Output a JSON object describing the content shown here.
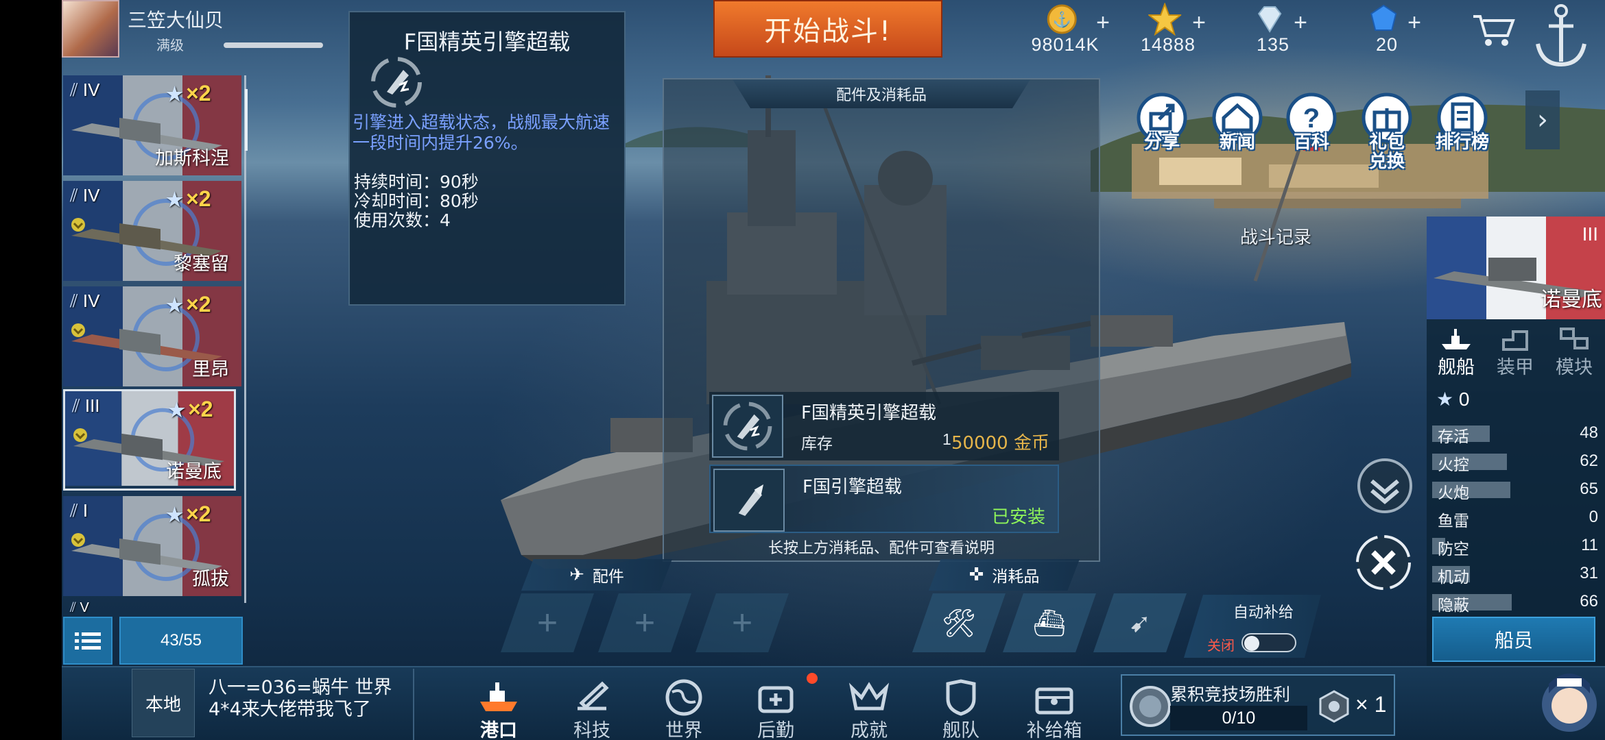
{
  "player": {
    "name": "三笠大仙贝",
    "level": "满级"
  },
  "start_battle": "开始战斗!",
  "resources": [
    {
      "icon": "gold-coin-icon",
      "value": "98014K",
      "color": "#f2b93a"
    },
    {
      "icon": "star-icon",
      "value": "14888",
      "color": "#f5c742"
    },
    {
      "icon": "diamond-icon",
      "value": "135",
      "color": "#d8e8f4"
    },
    {
      "icon": "blue-gem-icon",
      "value": "20",
      "color": "#3a8ff0"
    }
  ],
  "ship_list": [
    {
      "tier": "IV",
      "mult": "×2",
      "name": "加斯科涅"
    },
    {
      "tier": "IV",
      "mult": "×2",
      "name": "黎塞留"
    },
    {
      "tier": "IV",
      "mult": "×2",
      "name": "里昂"
    },
    {
      "tier": "III",
      "mult": "×2",
      "name": "诺曼底"
    },
    {
      "tier": "I",
      "mult": "×2",
      "name": "孤拔"
    },
    {
      "tier": "V"
    }
  ],
  "ship_count": "43/55",
  "tooltip": {
    "title": "F国精英引擎超载",
    "description": "引擎进入超载状态，战舰最大航速一段时间内提升26%。",
    "duration": "持续时间：90秒",
    "cooldown": "冷却时间：80秒",
    "uses": "使用次数：4"
  },
  "panel": {
    "title": "配件及消耗品",
    "item1": {
      "name": "F国精英引擎超载",
      "stock_label": "库存",
      "stock": "1",
      "price": "50000 金币"
    },
    "item2": {
      "name": "F国引擎超载",
      "status": "已安装"
    },
    "hint": "长按上方消耗品、配件可查看说明"
  },
  "tabs": {
    "parts": "配件",
    "consumables": "消耗品"
  },
  "auto_supply": {
    "label": "自动补给",
    "state": "关闭"
  },
  "right_buttons": [
    {
      "icon": "share-icon",
      "label": "分享"
    },
    {
      "icon": "news-icon",
      "label": "新闻"
    },
    {
      "icon": "wiki-icon",
      "label": "百科"
    },
    {
      "icon": "gift-icon",
      "label": "礼包\n兑换"
    },
    {
      "icon": "ranking-icon",
      "label": "排行榜"
    }
  ],
  "battle_record": "战斗记录",
  "current_ship": {
    "tier": "III",
    "name": "诺曼底"
  },
  "ship_tabs": [
    "舰船",
    "装甲",
    "模块"
  ],
  "ship_stars": "0",
  "stats": [
    {
      "label": "存活",
      "value": 48
    },
    {
      "label": "火控",
      "value": 62
    },
    {
      "label": "火炮",
      "value": 65
    },
    {
      "label": "鱼雷",
      "value": 0
    },
    {
      "label": "防空",
      "value": 11
    },
    {
      "label": "机动",
      "value": 31
    },
    {
      "label": "隐蔽",
      "value": 66
    }
  ],
  "crew": "船员",
  "chat": {
    "channel": "本地",
    "message": "八一=036=蜗牛 世界4*4来大佬带我飞了"
  },
  "nav": [
    {
      "icon": "harbor-icon",
      "label": "港口"
    },
    {
      "icon": "tech-icon",
      "label": "科技"
    },
    {
      "icon": "world-icon",
      "label": "世界"
    },
    {
      "icon": "logistics-icon",
      "label": "后勤"
    },
    {
      "icon": "achievement-icon",
      "label": "成就"
    },
    {
      "icon": "fleet-icon",
      "label": "舰队"
    },
    {
      "icon": "supply-box-icon",
      "label": "补给箱"
    }
  ],
  "arena": {
    "title": "累积竞技场胜利",
    "progress": "0/10",
    "reward": "× 1"
  }
}
